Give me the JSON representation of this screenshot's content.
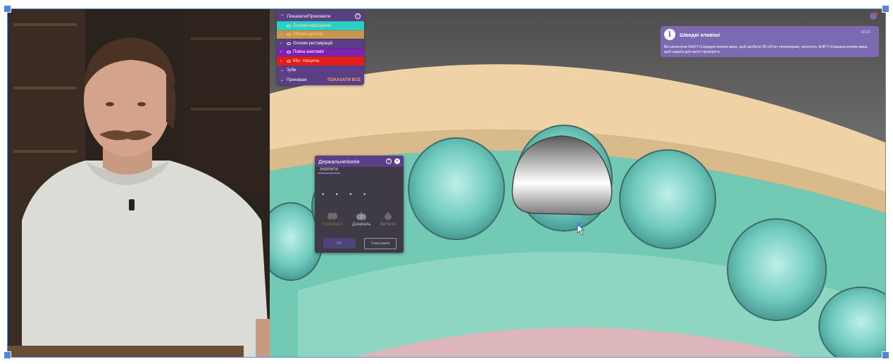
{
  "layers_panel": {
    "title": "Показати/Приховати",
    "help_icon": "?",
    "rows": [
      {
        "label": "Основи нарощення",
        "bg": "#2ccfc6",
        "color": "#f3e99a",
        "arrow": ""
      },
      {
        "label": "Обрані щелепи",
        "bg": "#c9964f",
        "color": "#ffd36b",
        "arrow": "›"
      },
      {
        "label": "Основи реставрацій",
        "bg": "#5b3f86",
        "color": "#ffffff",
        "arrow": "›"
      },
      {
        "label": "Повна анатомія",
        "bg": "#7b24b0",
        "color": "#ffffff",
        "arrow": "›"
      },
      {
        "label": "Мін. товщина",
        "bg": "#e41c1c",
        "color": "#ffe9b0",
        "arrow": "›"
      }
    ],
    "sections": [
      {
        "label": "Зуби",
        "arrow": "⌄"
      },
      {
        "label": "Приховані",
        "arrow": "⌄",
        "action": "ПОКАЗАТИ ВСЕ"
      }
    ]
  },
  "notification": {
    "icon": "i",
    "title": "Швидкі клавіші",
    "time": "10:21",
    "message": "Ви натиснули SHIFT+Середня кнопка миші, щоб зробити 3D-об'єкт непрозорим, натисніть SHIFT+Середня кнопка миші, щоб задати для нього прозорість"
  },
  "holder_dialog": {
    "title": "Держальне/копія",
    "help_icon": "?",
    "close_icon": "×",
    "tab": "ЗНЕРІЖТИ",
    "dots": "• • • •",
    "actions": [
      {
        "label": "Копіювати"
      },
      {
        "label": "Дзеркаль"
      },
      {
        "label": "Витягти"
      }
    ],
    "ok_label": "OK",
    "cancel_label": "Скасувати"
  },
  "icons": {
    "bell": "bell-icon",
    "eye": "eye-icon",
    "info": "info-icon"
  },
  "colors": {
    "panel_purple": "#5b3f86",
    "notification_purple": "#7b69b1",
    "gum_teal": "#69c9b5",
    "arch_beige": "#f0d6ab"
  }
}
